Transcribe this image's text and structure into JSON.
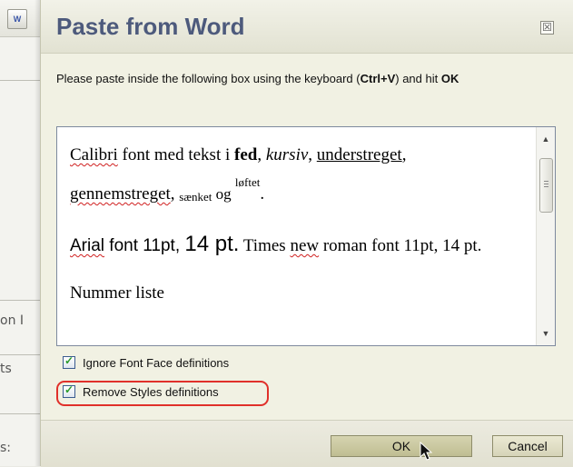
{
  "background": {
    "toolbar_icon": "paste-from-word-icon",
    "label_1": "on I",
    "label_2": "ts",
    "label_3": "s:"
  },
  "dialog": {
    "title": "Paste from Word",
    "close_glyph": "☒",
    "instructions": {
      "part1": "Please paste inside the following box using the keyboard (",
      "shortcut": "Ctrl+V",
      "part2": ") and hit ",
      "ok_word": "OK"
    },
    "content": {
      "p1": {
        "t1": "Calibri",
        "t2": " font med tekst i ",
        "bold": "fed",
        "t3": ", ",
        "italic": "kursiv",
        "t4": ", ",
        "underline": "understreget",
        "t5": ",",
        "strike": "gennemstreget",
        "t6": ", ",
        "sub": "sænket",
        "t7": " og ",
        "sup": "løftet",
        "t8": "."
      },
      "p2": {
        "arial1": "Arial",
        "arial2": " font 11pt, ",
        "big": "14 pt.",
        "times1": " Times ",
        "new": "new",
        "times2": " roman font 11pt, 14 pt."
      },
      "p3": "Nummer liste"
    },
    "options": [
      {
        "label": "Ignore Font Face definitions",
        "checked": true
      },
      {
        "label": "Remove Styles definitions",
        "checked": true
      }
    ],
    "buttons": {
      "ok": "OK",
      "cancel": "Cancel"
    }
  },
  "colors": {
    "title": "#4d5a7c",
    "highlight": "#e0302a",
    "check": "#2a9a2a"
  }
}
